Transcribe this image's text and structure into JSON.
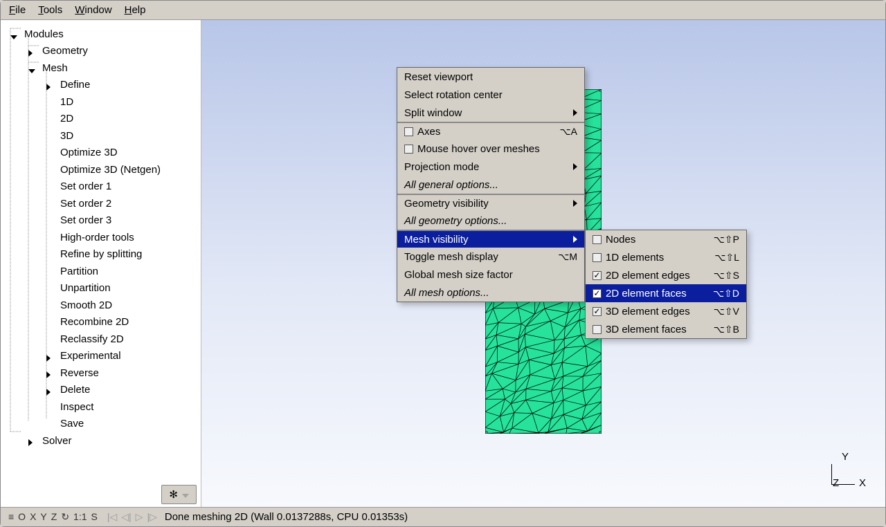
{
  "menubar": {
    "file": "File",
    "tools": "Tools",
    "window": "Window",
    "help": "Help"
  },
  "tree": {
    "root": "Modules",
    "geometry": "Geometry",
    "mesh": "Mesh",
    "mesh_items": [
      "Define",
      "1D",
      "2D",
      "3D",
      "Optimize 3D",
      "Optimize 3D (Netgen)",
      "Set order 1",
      "Set order 2",
      "Set order 3",
      "High-order tools",
      "Refine by splitting",
      "Partition",
      "Unpartition",
      "Smooth 2D",
      "Recombine 2D",
      "Reclassify 2D",
      "Experimental",
      "Reverse",
      "Delete",
      "Inspect",
      "Save"
    ],
    "solver": "Solver"
  },
  "context_main": [
    {
      "label": "Reset viewport"
    },
    {
      "label": "Select rotation center"
    },
    {
      "label": "Split window",
      "arrow": true
    },
    {
      "label": "Axes",
      "check": "empty",
      "accel": "⌥A",
      "sep": true
    },
    {
      "label": "Mouse hover over meshes",
      "check": "empty"
    },
    {
      "label": "Projection mode",
      "arrow": true
    },
    {
      "label": "All general options...",
      "italic": true
    },
    {
      "label": "Geometry visibility",
      "arrow": true,
      "sep": true
    },
    {
      "label": "All geometry options...",
      "italic": true
    },
    {
      "label": "Mesh visibility",
      "arrow": true,
      "hl": true,
      "sep": true
    },
    {
      "label": "Toggle mesh display",
      "accel": "⌥M"
    },
    {
      "label": "Global mesh size factor"
    },
    {
      "label": "All mesh options...",
      "italic": true
    }
  ],
  "context_sub": [
    {
      "label": "Nodes",
      "check": "empty",
      "accel": "⌥⇧P"
    },
    {
      "label": "1D elements",
      "check": "empty",
      "accel": "⌥⇧L"
    },
    {
      "label": "2D element edges",
      "check": "checked",
      "accel": "⌥⇧S"
    },
    {
      "label": "2D element faces",
      "check": "checked",
      "accel": "⌥⇧D",
      "hl": true
    },
    {
      "label": "3D element edges",
      "check": "checked",
      "accel": "⌥⇧V"
    },
    {
      "label": "3D element faces",
      "check": "empty",
      "accel": "⌥⇧B"
    }
  ],
  "status": {
    "icons": [
      "≡",
      "O",
      "X",
      "Y",
      "Z",
      "↻",
      "1:1",
      "S"
    ],
    "play_icons": [
      "|◁",
      "◁|",
      "▷",
      "|▷"
    ],
    "text": "Done meshing 2D (Wall 0.0137288s, CPU 0.01353s)"
  },
  "axes": {
    "x": "X",
    "y": "Y",
    "z": "Z"
  }
}
